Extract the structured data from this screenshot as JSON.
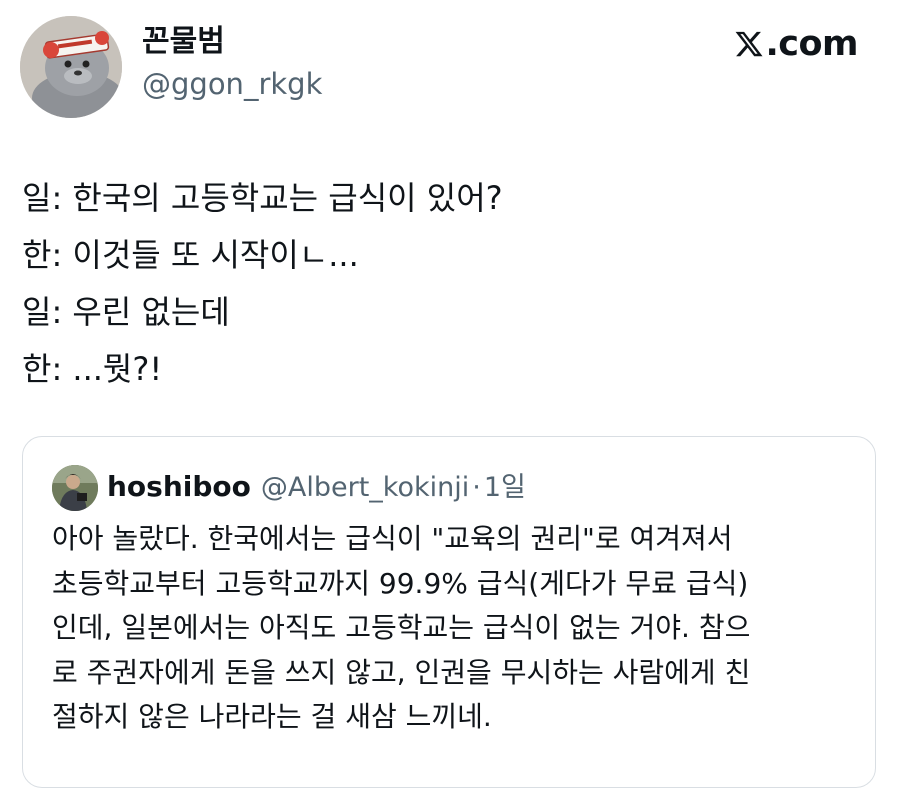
{
  "author": {
    "name": "꼰물범",
    "handle": "@ggon_rkgk",
    "avatar_icon": "seal-avatar-icon"
  },
  "brand": {
    "label": ".com",
    "icon": "x-logo-icon"
  },
  "tweet": {
    "lines": [
      "일: 한국의 고등학교는 급식이 있어?",
      "한: 이것들 또 시작이ㄴ...",
      "일: 우린 없는데",
      "한: ...뭣?!"
    ]
  },
  "quote": {
    "name": "hoshiboo",
    "handle": "@Albert_kokinji",
    "separator": "·",
    "time": "1일",
    "avatar_icon": "person-avatar-icon",
    "lines": [
      "아아 놀랐다. 한국에서는 급식이 \"교육의 권리\"로 여겨져서",
      "초등학교부터 고등학교까지 99.9% 급식(게다가 무료 급식)",
      "인데, 일본에서는 아직도 고등학교는 급식이 없는 거야. 참으",
      "로 주권자에게 돈을 쓰지 않고, 인권을 무시하는 사람에게 친",
      "절하지 않은 나라라는 걸 새삼 느끼네."
    ]
  },
  "colors": {
    "text": "#0f1419",
    "secondary": "#536471",
    "card_border": "#d9dee3",
    "background": "#ffffff"
  }
}
